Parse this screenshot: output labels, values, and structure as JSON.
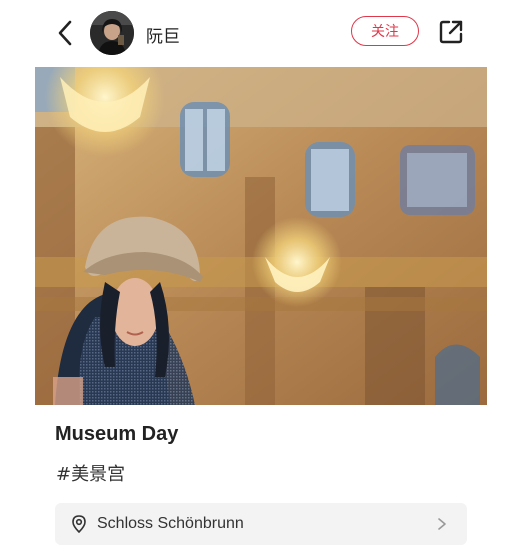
{
  "header": {
    "username": "阮巨",
    "follow_label": "关注",
    "back_icon": "chevron-left-icon",
    "share_icon": "share-external-icon"
  },
  "post": {
    "title": "Museum Day",
    "hashtag": "#美景宫",
    "location": "Schloss Schönbrunn"
  },
  "colors": {
    "accent": "#e0374a",
    "location_bg": "#f3f3f3"
  }
}
